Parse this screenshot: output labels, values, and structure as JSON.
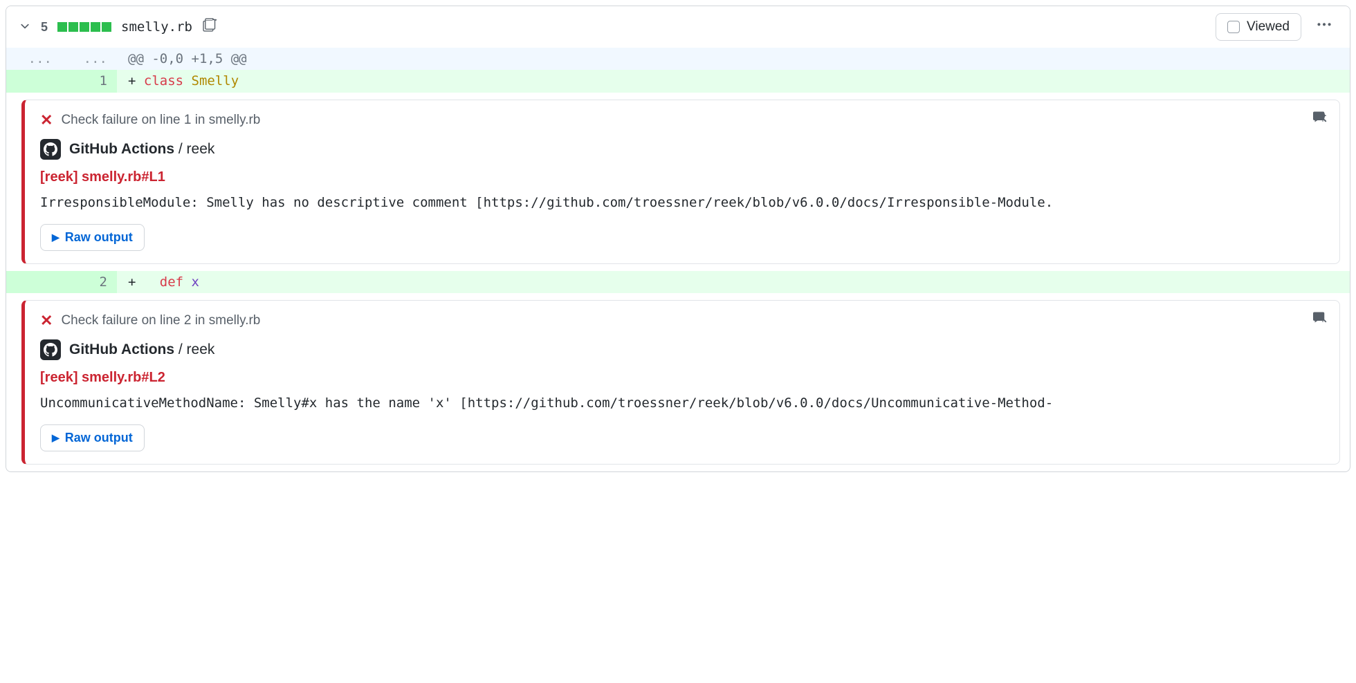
{
  "file": {
    "changes_count": "5",
    "name": "smelly.rb",
    "viewed_label": "Viewed"
  },
  "hunk_header": "@@ -0,0 +1,5 @@",
  "lines": [
    {
      "num": "1",
      "prefix": "+ ",
      "tokens": {
        "kw": "class",
        "rest": " Smelly"
      }
    },
    {
      "num": "2",
      "prefix": "+   ",
      "tokens": {
        "kw": "def",
        "rest": " x"
      }
    }
  ],
  "annotations": [
    {
      "header": "Check failure on line 1 in smelly.rb",
      "source_strong": "GitHub Actions",
      "source_rest": " / reek",
      "title": "[reek] smelly.rb#L1",
      "message": "IrresponsibleModule: Smelly has no descriptive comment [https://github.com/troessner/reek/blob/v6.0.0/docs/Irresponsible-Module.",
      "raw_label": "Raw output"
    },
    {
      "header": "Check failure on line 2 in smelly.rb",
      "source_strong": "GitHub Actions",
      "source_rest": " / reek",
      "title": "[reek] smelly.rb#L2",
      "message": "UncommunicativeMethodName: Smelly#x has the name 'x' [https://github.com/troessner/reek/blob/v6.0.0/docs/Uncommunicative-Method-",
      "raw_label": "Raw output"
    }
  ],
  "ellipsis": "..."
}
